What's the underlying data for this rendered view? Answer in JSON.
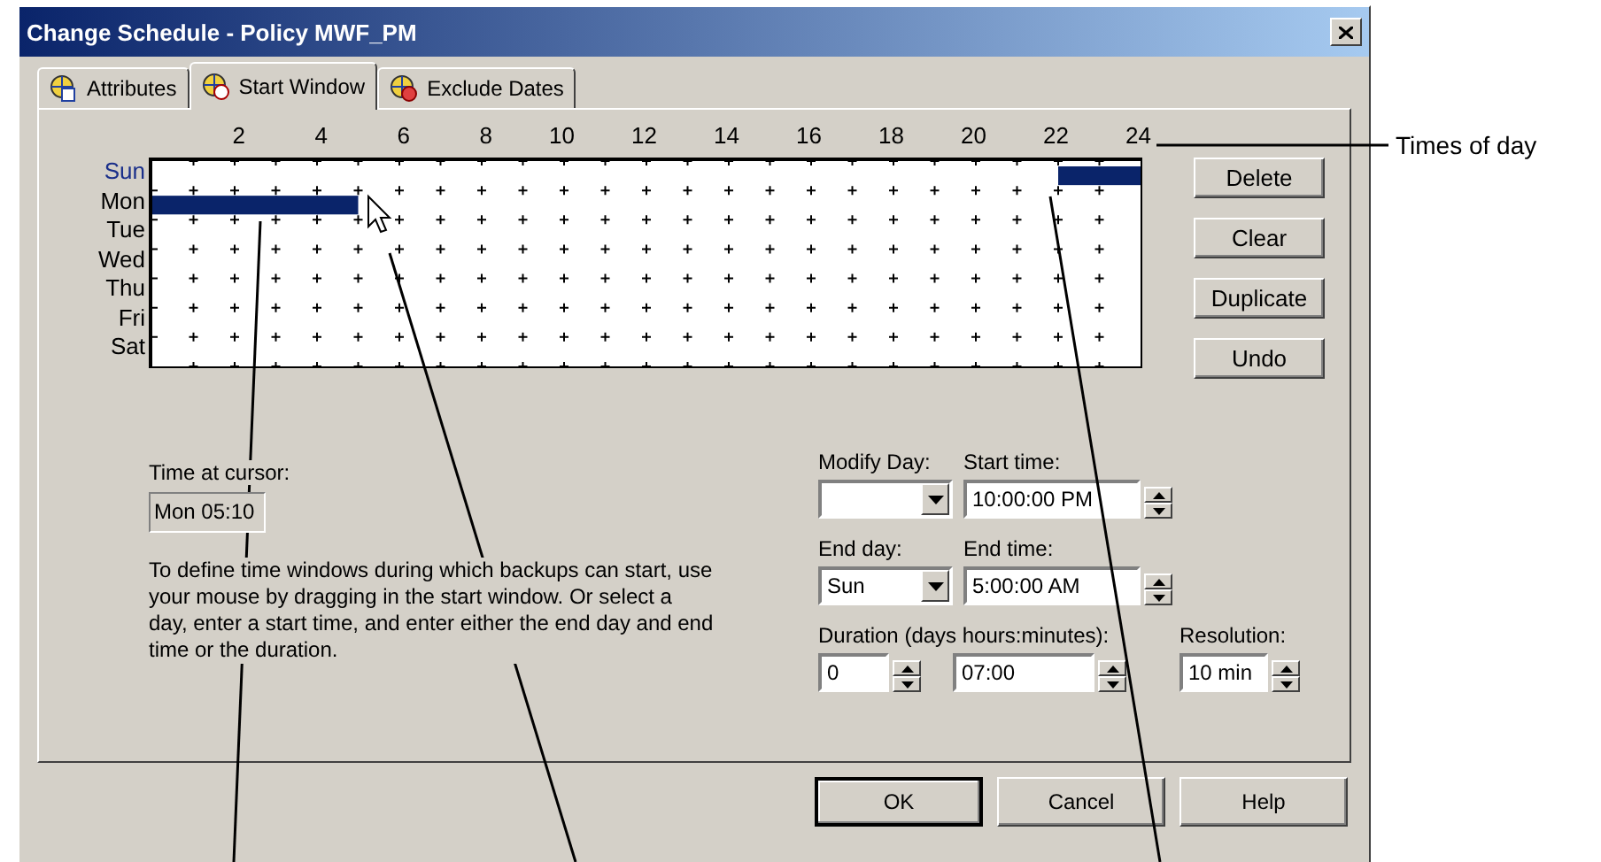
{
  "window": {
    "title": "Change Schedule - Policy MWF_PM"
  },
  "tabs": [
    {
      "label": "Attributes",
      "selected": false
    },
    {
      "label": "Start Window",
      "selected": true
    },
    {
      "label": "Exclude Dates",
      "selected": false
    }
  ],
  "schedule": {
    "hour_labels": [
      "2",
      "4",
      "6",
      "8",
      "10",
      "12",
      "14",
      "16",
      "18",
      "20",
      "22",
      "24"
    ],
    "days": [
      {
        "label": "Sun",
        "highlighted": true,
        "hours": [
          false,
          false,
          false,
          false,
          false,
          false,
          false,
          false,
          false,
          false,
          false,
          false,
          false,
          false,
          false,
          false,
          false,
          false,
          false,
          false,
          false,
          false,
          true,
          true
        ]
      },
      {
        "label": "Mon",
        "highlighted": false,
        "hours": [
          true,
          true,
          true,
          true,
          true,
          false,
          false,
          false,
          false,
          false,
          false,
          false,
          false,
          false,
          false,
          false,
          false,
          false,
          false,
          false,
          false,
          false,
          false,
          false
        ]
      },
      {
        "label": "Tue",
        "highlighted": false,
        "hours": [
          false,
          false,
          false,
          false,
          false,
          false,
          false,
          false,
          false,
          false,
          false,
          false,
          false,
          false,
          false,
          false,
          false,
          false,
          false,
          false,
          false,
          false,
          false,
          false
        ]
      },
      {
        "label": "Wed",
        "highlighted": false,
        "hours": [
          false,
          false,
          false,
          false,
          false,
          false,
          false,
          false,
          false,
          false,
          false,
          false,
          false,
          false,
          false,
          false,
          false,
          false,
          false,
          false,
          false,
          false,
          false,
          false
        ]
      },
      {
        "label": "Thu",
        "highlighted": false,
        "hours": [
          false,
          false,
          false,
          false,
          false,
          false,
          false,
          false,
          false,
          false,
          false,
          false,
          false,
          false,
          false,
          false,
          false,
          false,
          false,
          false,
          false,
          false,
          false,
          false
        ]
      },
      {
        "label": "Fri",
        "highlighted": false,
        "hours": [
          false,
          false,
          false,
          false,
          false,
          false,
          false,
          false,
          false,
          false,
          false,
          false,
          false,
          false,
          false,
          false,
          false,
          false,
          false,
          false,
          false,
          false,
          false,
          false
        ]
      },
      {
        "label": "Sat",
        "highlighted": false,
        "hours": [
          false,
          false,
          false,
          false,
          false,
          false,
          false,
          false,
          false,
          false,
          false,
          false,
          false,
          false,
          false,
          false,
          false,
          false,
          false,
          false,
          false,
          false,
          false,
          false
        ]
      }
    ]
  },
  "side_buttons": [
    "Delete",
    "Clear",
    "Duplicate",
    "Undo"
  ],
  "time_at_cursor": {
    "label": "Time at cursor:",
    "value": "Mon 05:10"
  },
  "instructions": "To define time windows during which backups can start, use your mouse by dragging in the start window.  Or select a day, enter a start time, and enter either the end day and end time or the duration.",
  "modify_day": {
    "label": "Modify Day:"
  },
  "start_time": {
    "label": "Start time:",
    "value": "10:00:00 PM"
  },
  "end_day": {
    "label": "End day:",
    "value": "Sun"
  },
  "end_time": {
    "label": "End time:",
    "value": "5:00:00 AM"
  },
  "duration": {
    "label": "Duration (days hours:minutes):",
    "days": "0",
    "time": "07:00"
  },
  "resolution": {
    "label": "Resolution:",
    "value": "10 min"
  },
  "dialog_buttons": [
    {
      "label": "OK",
      "default": true
    },
    {
      "label": "Cancel",
      "default": false
    },
    {
      "label": "Help",
      "default": false
    }
  ],
  "callout": {
    "text": "Times of day"
  }
}
